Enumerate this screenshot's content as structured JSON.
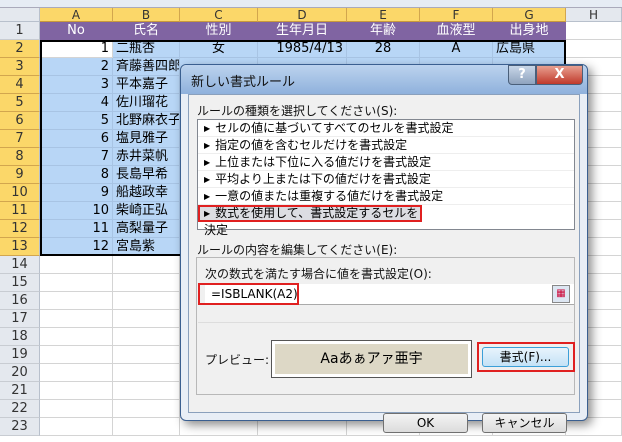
{
  "columns": [
    "A",
    "B",
    "C",
    "D",
    "E",
    "F",
    "G",
    "H"
  ],
  "rows": [
    "1",
    "2",
    "3",
    "4",
    "5",
    "6",
    "7",
    "8",
    "9",
    "10",
    "11",
    "12",
    "13",
    "14",
    "15",
    "16",
    "17",
    "18",
    "19",
    "20",
    "21",
    "22",
    "23"
  ],
  "table": {
    "headers": [
      "No",
      "氏名",
      "性別",
      "生年月日",
      "年齢",
      "血液型",
      "出身地"
    ],
    "row2": [
      "1",
      "二瓶杏",
      "女",
      "1985/4/13",
      "28",
      "A",
      "広島県"
    ],
    "visible": [
      [
        "2",
        "斉藤善四郎"
      ],
      [
        "3",
        "平本嘉子"
      ],
      [
        "4",
        "佐川瑠花"
      ],
      [
        "5",
        "北野麻衣子"
      ],
      [
        "6",
        "塩見雅子"
      ],
      [
        "7",
        "赤井菜帆"
      ],
      [
        "8",
        "長島早希"
      ],
      [
        "9",
        "船越政幸"
      ],
      [
        "10",
        "柴崎正弘"
      ],
      [
        "11",
        "高梨量子"
      ],
      [
        "12",
        "宮島紫"
      ]
    ]
  },
  "dialog": {
    "title": "新しい書式ルール",
    "help": "?",
    "close": "X",
    "rule_type_label": "ルールの種類を選択してください(S):",
    "rule_types": [
      "セルの値に基づいてすべてのセルを書式設定",
      "指定の値を含むセルだけを書式設定",
      "上位または下位に入る値だけを書式設定",
      "平均より上または下の値だけを書式設定",
      "一意の値または重複する値だけを書式設定",
      "数式を使用して、書式設定するセルを決定"
    ],
    "edit_label": "ルールの内容を編集してください(E):",
    "formula_label": "次の数式を満たす場合に値を書式設定(O):",
    "formula": "=ISBLANK(A2)",
    "preview_label": "プレビュー:",
    "preview_text": "Aaあぁアァ亜宇",
    "format_button": "書式(F)...",
    "ok": "OK",
    "cancel": "キャンセル"
  },
  "colors": {
    "header": "#8064a2",
    "selection": "#b8d6f6",
    "highlight": "#e02020"
  }
}
